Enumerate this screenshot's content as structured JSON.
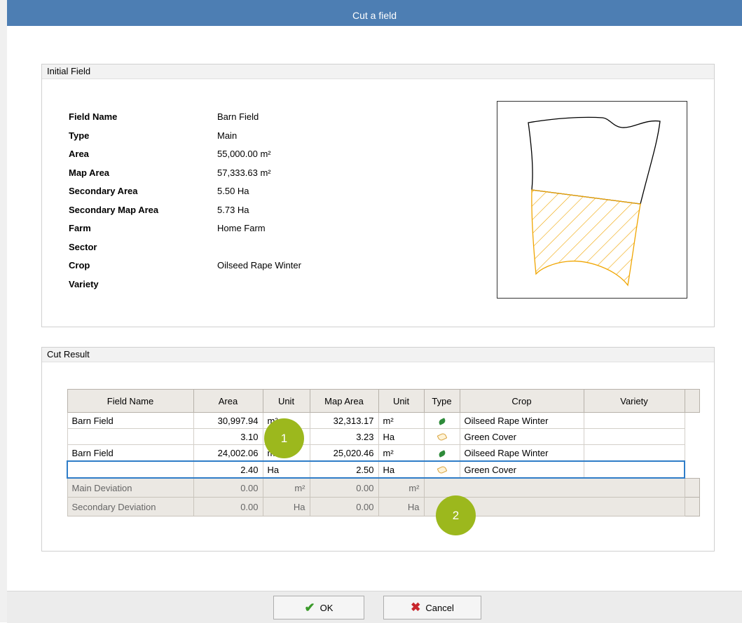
{
  "window": {
    "title": "Cut a field"
  },
  "initial_field": {
    "header": "Initial Field",
    "properties": [
      {
        "label": "Field Name",
        "value": "Barn Field"
      },
      {
        "label": "Type",
        "value": "Main"
      },
      {
        "label": "Area",
        "value": "55,000.00 m²"
      },
      {
        "label": "Map Area",
        "value": "57,333.63 m²"
      },
      {
        "label": "Secondary Area",
        "value": "5.50 Ha"
      },
      {
        "label": "Secondary Map Area",
        "value": "5.73 Ha"
      },
      {
        "label": "Farm",
        "value": "Home Farm"
      },
      {
        "label": "Sector",
        "value": ""
      },
      {
        "label": "Crop",
        "value": "Oilseed Rape Winter"
      },
      {
        "label": "Variety",
        "value": ""
      }
    ],
    "preview": {
      "outline_color": "#000000",
      "hatch_color": "#f0a500"
    }
  },
  "cut_result": {
    "header": "Cut Result",
    "columns": [
      "Field Name",
      "Area",
      "Unit",
      "Map Area",
      "Unit",
      "Type",
      "Crop",
      "Variety"
    ],
    "rows": [
      {
        "field_name": "Barn Field",
        "area": "30,997.94",
        "unit": "m²",
        "map_area": "32,313.17",
        "map_unit": "m²",
        "type_icon": "main-crop-icon",
        "crop": "Oilseed Rape Winter",
        "variety": ""
      },
      {
        "field_name": "",
        "area": "3.10",
        "unit": "Ha",
        "map_area": "3.23",
        "map_unit": "Ha",
        "type_icon": "secondary-crop-icon",
        "crop": "Green Cover",
        "variety": ""
      },
      {
        "field_name": "Barn Field",
        "area": "24,002.06",
        "unit": "m²",
        "map_area": "25,020.46",
        "map_unit": "m²",
        "type_icon": "main-crop-icon",
        "crop": "Oilseed Rape Winter",
        "variety": ""
      },
      {
        "field_name": "",
        "area": "2.40",
        "unit": "Ha",
        "map_area": "2.50",
        "map_unit": "Ha",
        "type_icon": "secondary-crop-icon",
        "crop": "Green Cover",
        "variety": ""
      }
    ],
    "deviations": [
      {
        "label": "Main Deviation",
        "area": "0.00",
        "unit": "m²",
        "map_area": "0.00",
        "map_unit": "m²"
      },
      {
        "label": "Secondary Deviation",
        "area": "0.00",
        "unit": "Ha",
        "map_area": "0.00",
        "map_unit": "Ha"
      }
    ]
  },
  "callouts": {
    "one": "1",
    "two": "2",
    "color": "#9cb81d"
  },
  "buttons": {
    "ok": "OK",
    "cancel": "Cancel"
  }
}
